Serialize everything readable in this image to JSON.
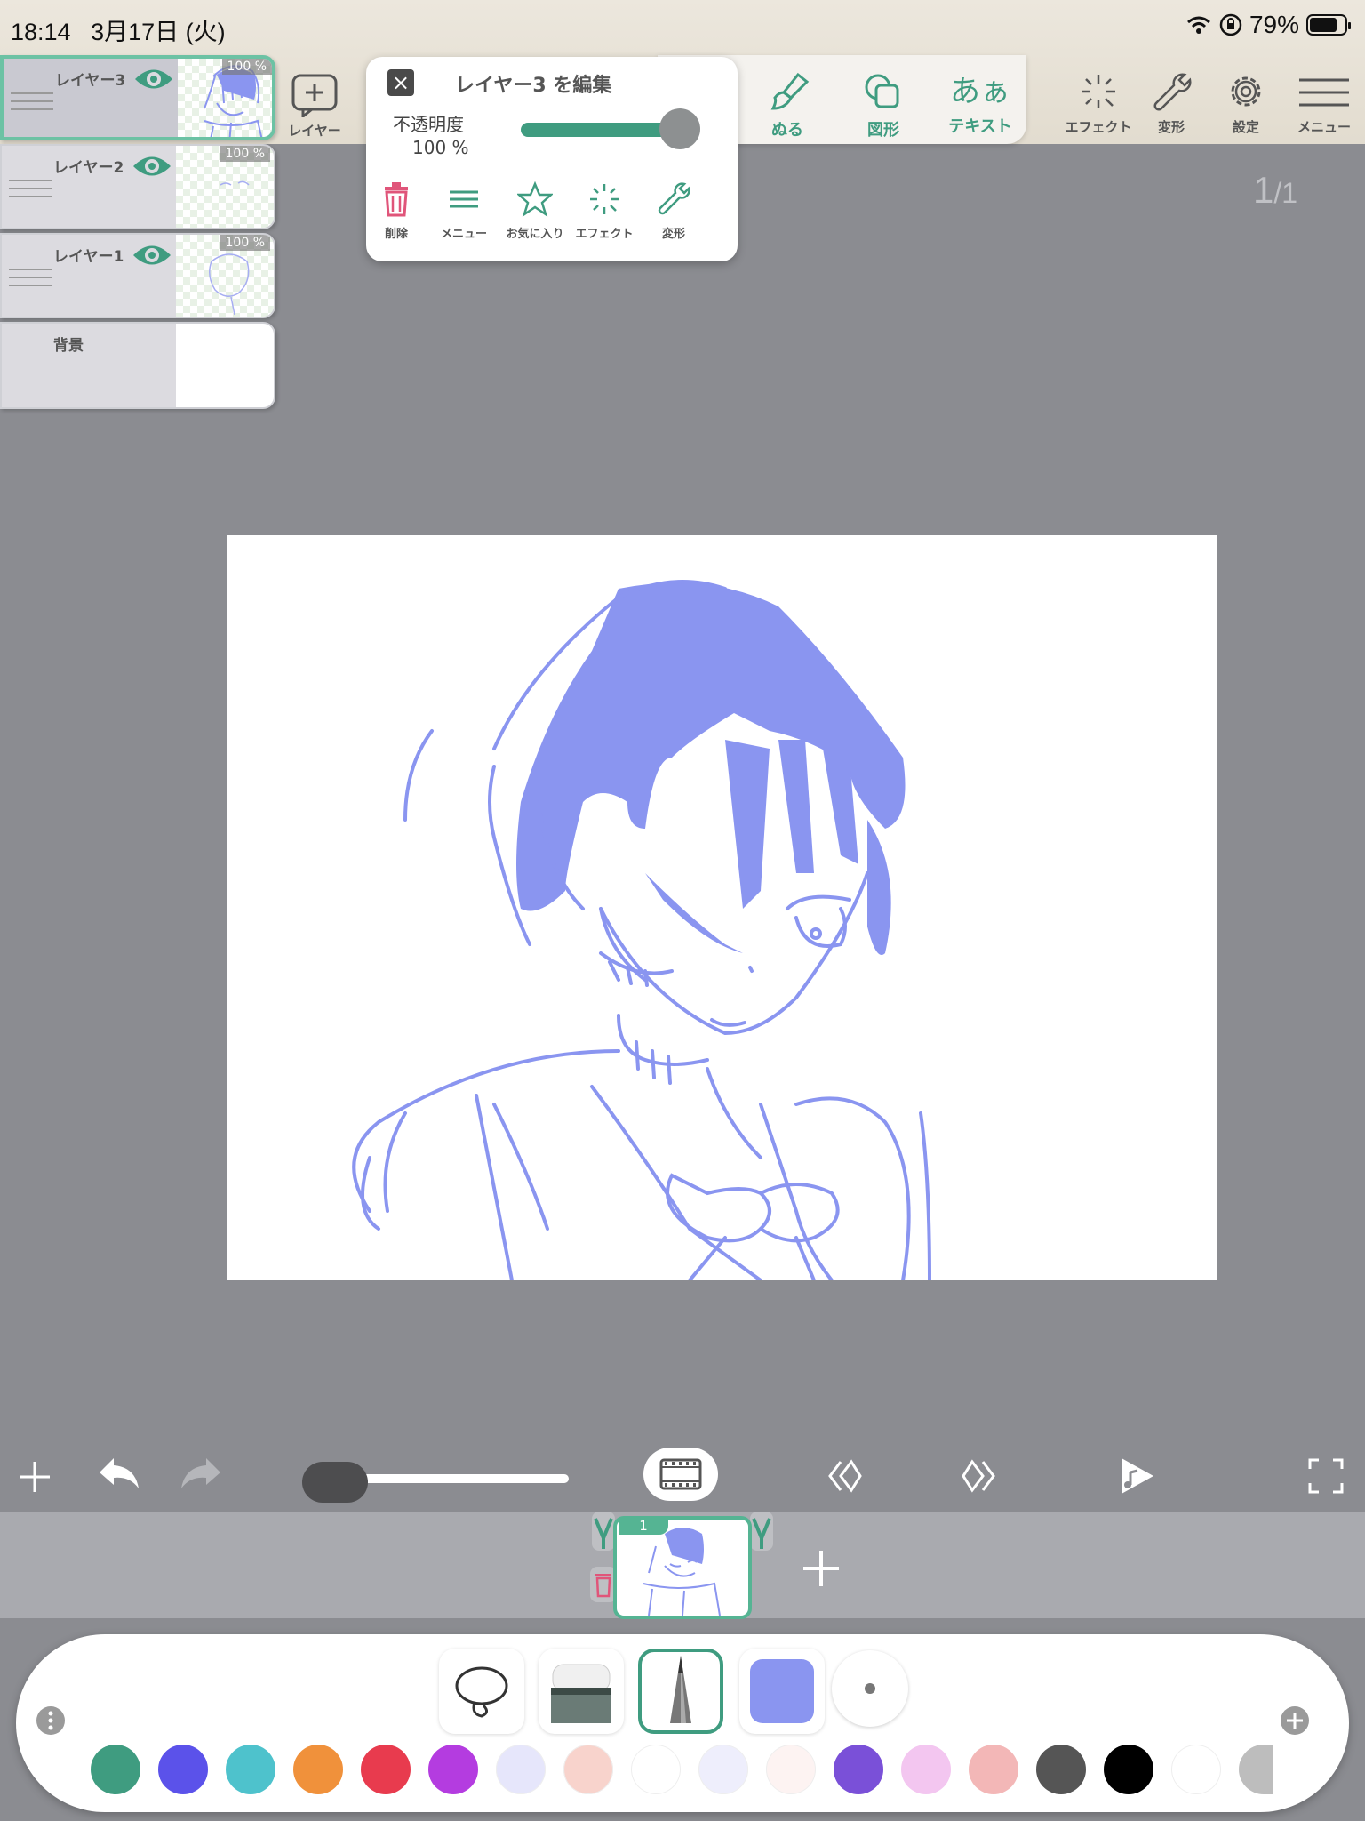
{
  "status": {
    "time": "18:14",
    "date": "3月17日 (火)",
    "battery": "79%"
  },
  "toolbar": {
    "layer_label": "レイヤー",
    "fill_label": "ぬる",
    "shape_label": "図形",
    "text_icon": "あぁ",
    "text_label": "テキスト",
    "effect_label": "エフェクト",
    "transform_label": "変形",
    "settings_label": "設定",
    "menu_label": "メニュー"
  },
  "layers": [
    {
      "name": "レイヤー3",
      "opacity": "100 %",
      "visible": true,
      "active": true
    },
    {
      "name": "レイヤー2",
      "opacity": "100 %",
      "visible": true,
      "active": false
    },
    {
      "name": "レイヤー1",
      "opacity": "100 %",
      "visible": true,
      "active": false
    },
    {
      "name": "背景",
      "opacity": "",
      "visible": true,
      "active": false
    }
  ],
  "edit_popup": {
    "title": "レイヤー3 を編集",
    "opacity_label": "不透明度",
    "opacity_value": "100 %",
    "opacity_fraction": 1.0,
    "actions": {
      "delete": "削除",
      "menu": "メニュー",
      "favorite": "お気に入り",
      "effect": "エフェクト",
      "transform": "変形"
    }
  },
  "page_counter": {
    "current": "1",
    "total": "1"
  },
  "frames": {
    "frame_1_number": "1"
  },
  "colors": {
    "accent": "#3f9c80",
    "sketch": "#8a95f0",
    "delete": "#e0557a",
    "swatches": [
      "#3f9c80",
      "#5b52ea",
      "#4ec2cc",
      "#f0913b",
      "#e83b4e",
      "#b43ce0",
      "#e6e6fb",
      "#f8d3cc",
      "#ffffff",
      "#eeeefc",
      "#fdf3f2",
      "#7a50d8",
      "#f3c6f0",
      "#f3b7b7",
      "#555555",
      "#000000",
      "#ffffff",
      "#bdbdbd"
    ]
  },
  "current_color": "#8a95f0"
}
